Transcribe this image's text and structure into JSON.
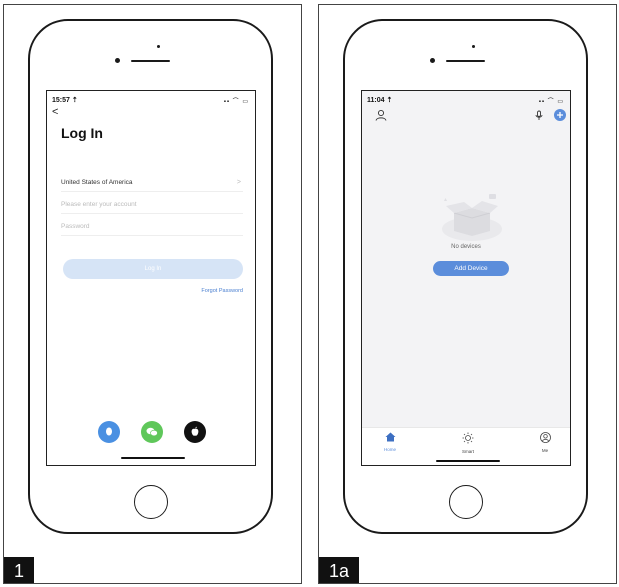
{
  "panel1": {
    "label": "1",
    "status": {
      "time": "15:57 ⇡",
      "icons": "▪▪ ⌒ ▭"
    },
    "back": "<",
    "title": "Log In",
    "country": "United States of America",
    "country_chevron": ">",
    "account_placeholder": "Please enter your account",
    "password_placeholder": "Password",
    "login_button": "Log In",
    "forgot_password": "Forgot Password",
    "social_colors": {
      "qq": "#4a90e2",
      "wechat": "#5fc75a",
      "apple": "#111111"
    }
  },
  "panel2": {
    "label": "1a",
    "status": {
      "time": "11:04 ⇡",
      "icons": "▪▪ ⌒ ▭"
    },
    "empty_text": "No devices",
    "add_device": "Add Device",
    "tabs": [
      {
        "label": "Home",
        "icon": "home-icon",
        "active": true
      },
      {
        "label": "Smart",
        "icon": "sun-icon",
        "active": false
      },
      {
        "label": "Me",
        "icon": "profile-icon",
        "active": false
      }
    ],
    "accent": "#5b8ddb"
  }
}
